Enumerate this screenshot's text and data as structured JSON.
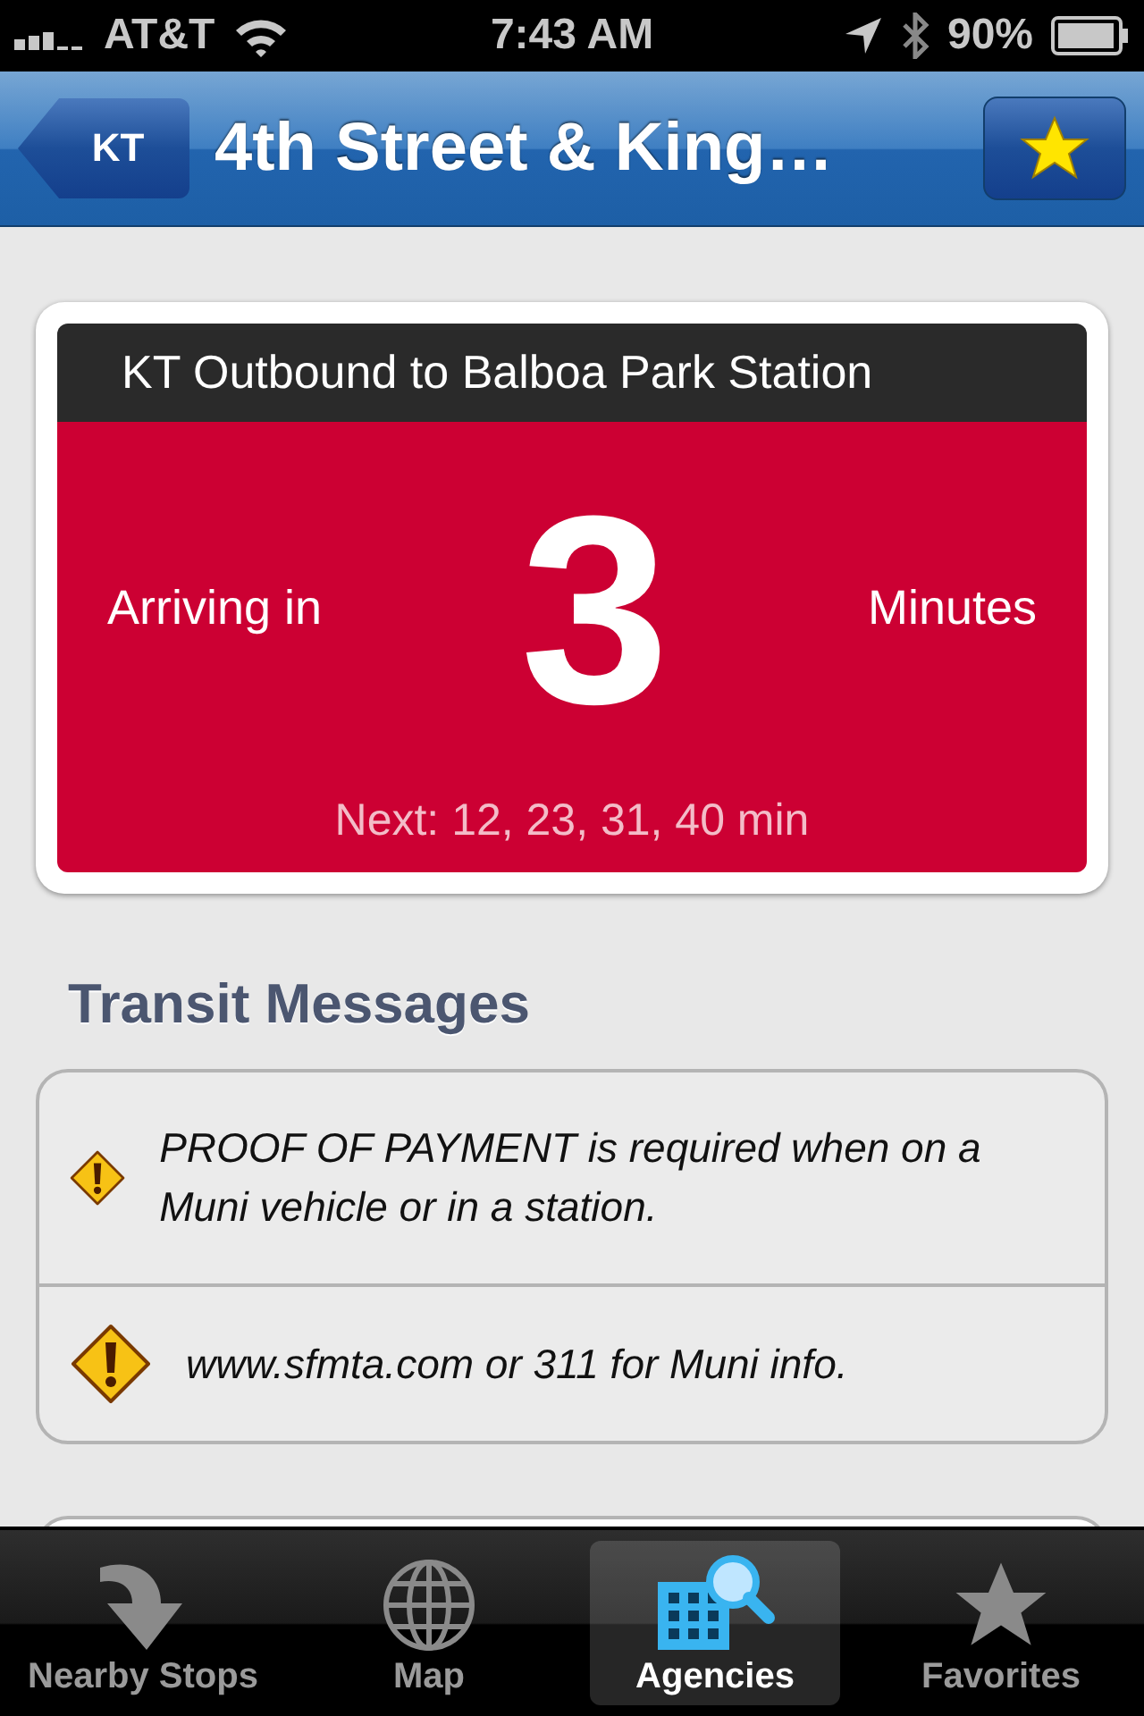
{
  "status_bar": {
    "carrier": "AT&T",
    "time": "7:43 AM",
    "battery": "90%"
  },
  "nav_bar": {
    "back_button": "KT",
    "title": "4th Street & King…"
  },
  "arrival": {
    "route": "KT Outbound to Balboa Park Station",
    "prefix": "Arriving in",
    "minutes": "3",
    "suffix": "Minutes",
    "next": "Next: 12, 23, 31, 40 min"
  },
  "transit_messages": {
    "heading": "Transit Messages",
    "items": [
      {
        "text": "PROOF OF PAYMENT is required when on a Muni vehicle or in a station."
      },
      {
        "text": "www.sfmta.com or 311 for Muni info."
      }
    ]
  },
  "tab_bar": [
    {
      "label": "Nearby Stops",
      "kind": "arrow",
      "selected": false
    },
    {
      "label": "Map",
      "kind": "globe",
      "selected": false
    },
    {
      "label": "Agencies",
      "kind": "agencies",
      "selected": true
    },
    {
      "label": "Favorites",
      "kind": "star",
      "selected": false
    }
  ]
}
